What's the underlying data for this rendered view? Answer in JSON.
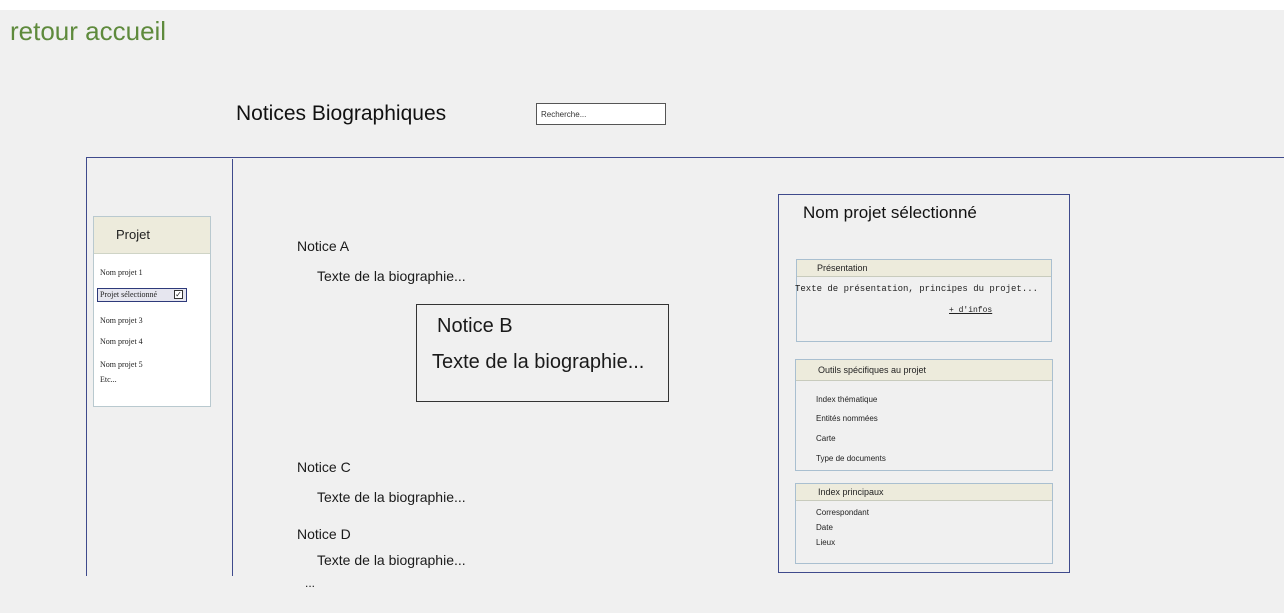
{
  "nav": {
    "home_link": "retour accueil"
  },
  "header": {
    "title": "Notices Biographiques",
    "search_placeholder": "Recherche..."
  },
  "sidebar": {
    "heading": "Projet",
    "items": [
      {
        "label": "Nom projet 1"
      },
      {
        "label": "Projet sélectionné",
        "selected": true,
        "checkbox": "✓"
      },
      {
        "label": "Nom projet 3"
      },
      {
        "label": "Nom projet 4"
      },
      {
        "label": "Nom projet 5"
      },
      {
        "label": "Etc..."
      }
    ]
  },
  "notices": [
    {
      "title": "Notice A",
      "text": "Texte de la biographie..."
    },
    {
      "title": "Notice B",
      "text": "Texte de la biographie..."
    },
    {
      "title": "Notice C",
      "text": "Texte de la biographie..."
    },
    {
      "title": "Notice D",
      "text": "Texte de la biographie..."
    }
  ],
  "notices_more": "...",
  "project_panel": {
    "title": "Nom projet sélectionné",
    "presentation": {
      "heading": "Présentation",
      "text": "Texte de présentation, principes du projet...",
      "more_link": "+ d'infos"
    },
    "tools": {
      "heading": "Outils spécifiques au projet",
      "items": [
        "Index thématique",
        "Entités nommées",
        "Carte",
        "Type de documents"
      ]
    },
    "indexes": {
      "heading": "Index principaux",
      "items": [
        "Correspondant",
        "Date",
        "Lieux"
      ]
    }
  },
  "colors": {
    "home_link": "#5e8a3c",
    "rule": "#3f4a8c",
    "header_fill": "#edebdc",
    "background": "#f0f0f0"
  }
}
